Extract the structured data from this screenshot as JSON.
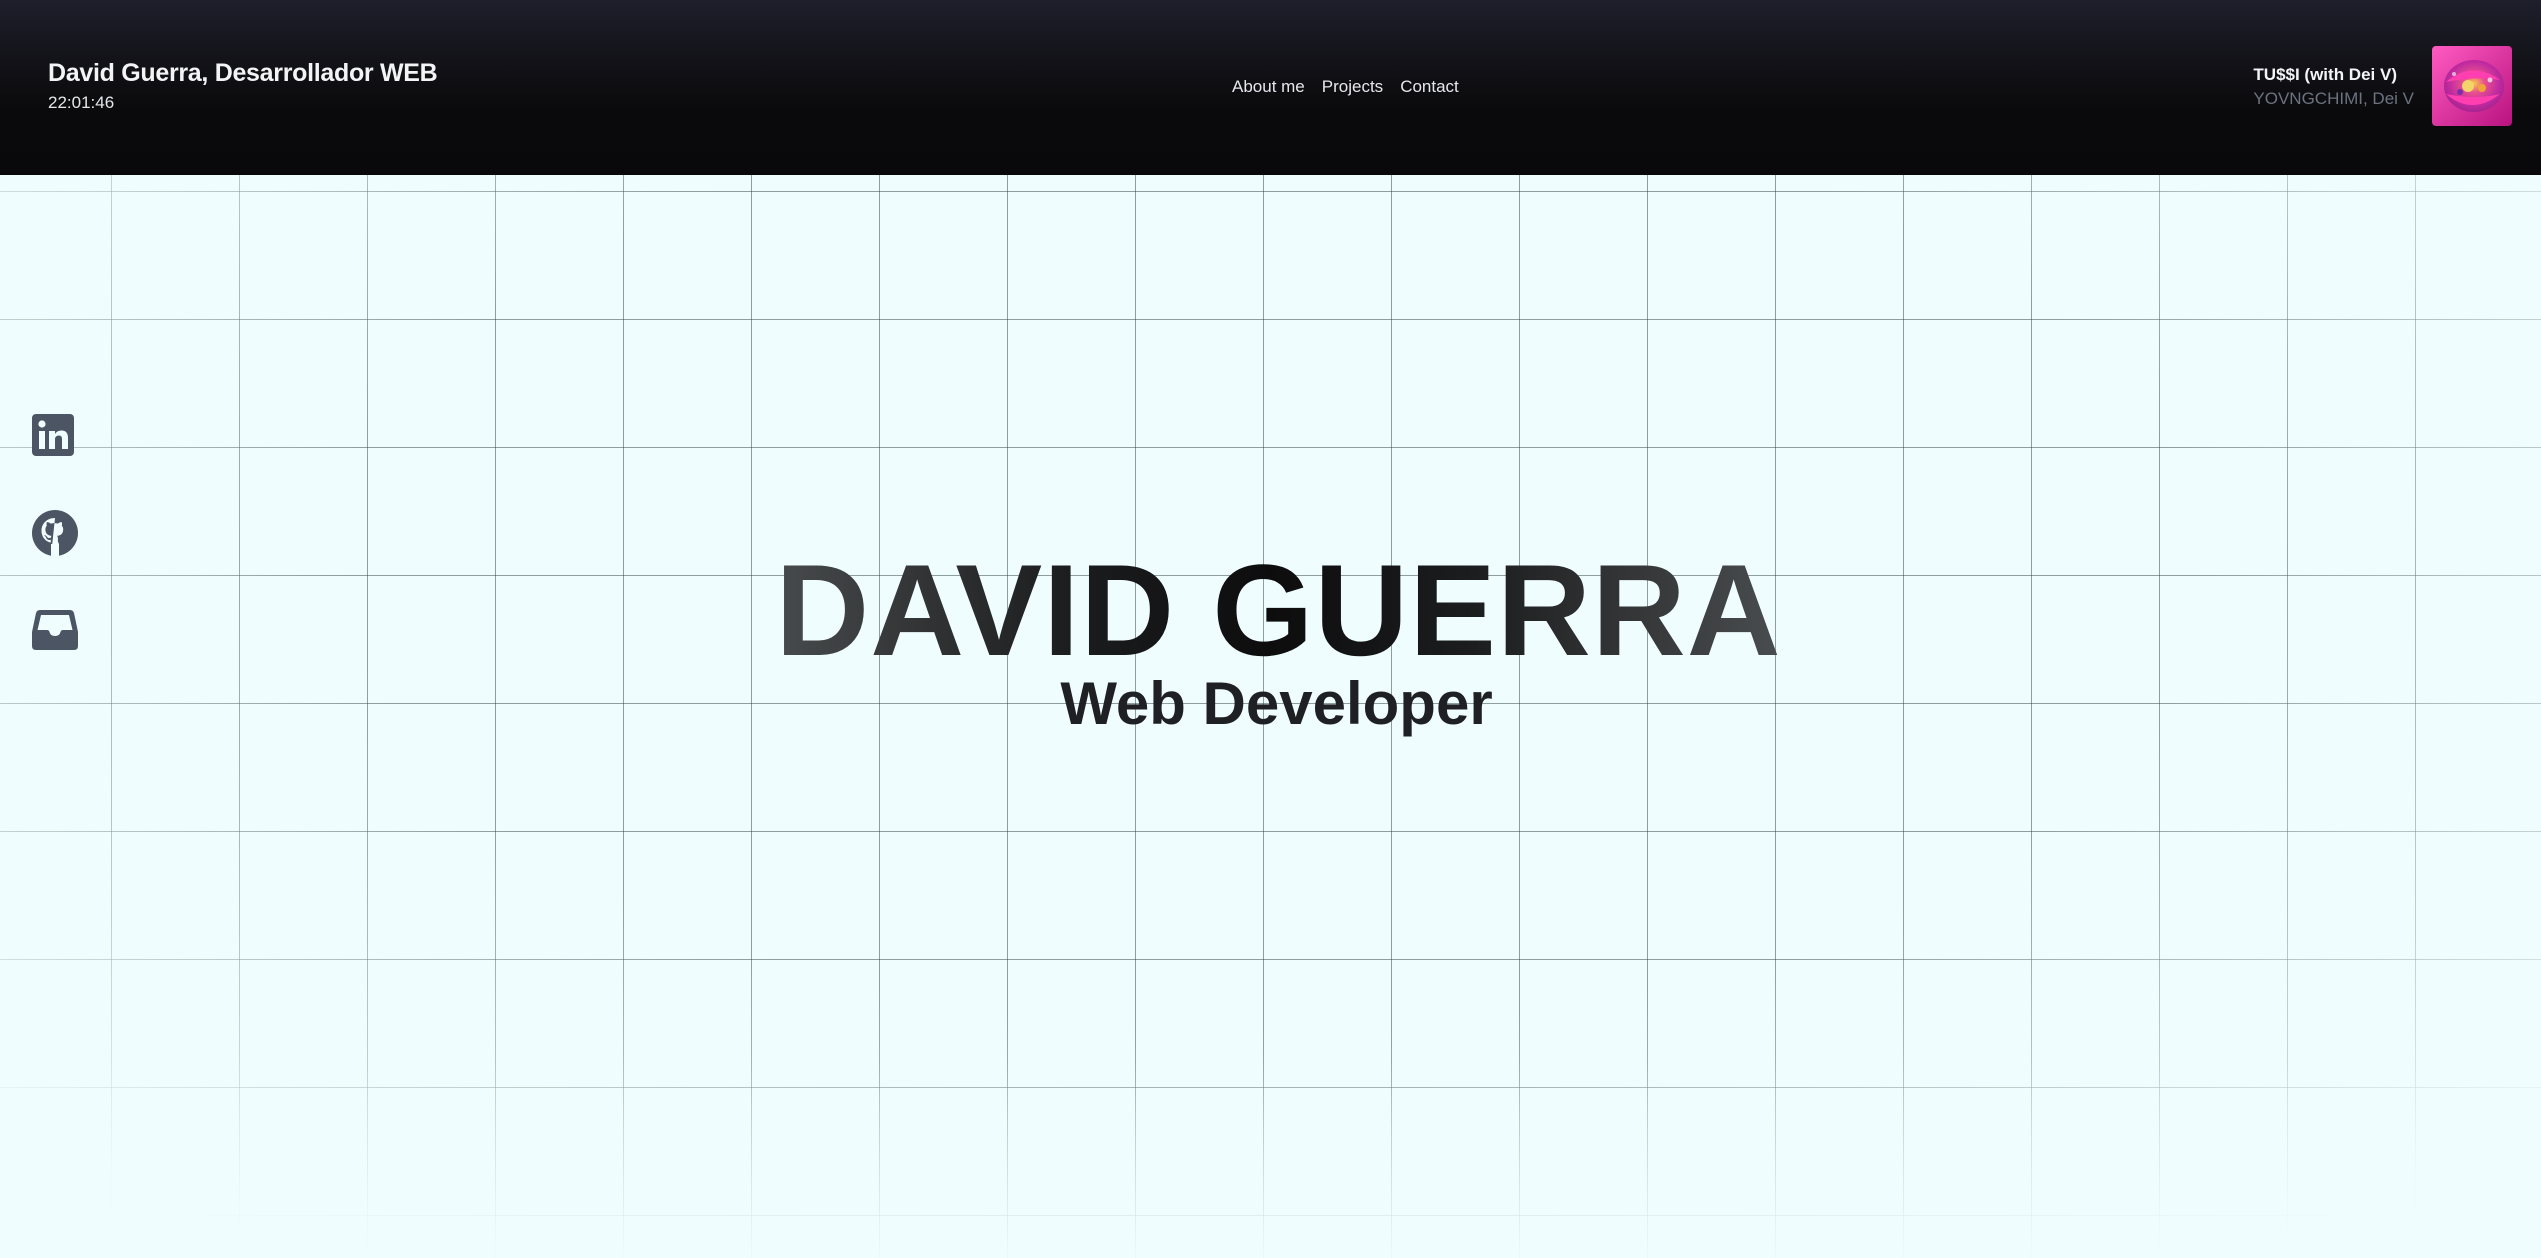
{
  "header": {
    "brand_title": "David Guerra, Desarrollador WEB",
    "clock": "22:01:46",
    "nav": [
      {
        "label": "About me"
      },
      {
        "label": "Projects"
      },
      {
        "label": "Contact"
      }
    ],
    "now_playing": {
      "title": "TU$$I (with Dei V)",
      "artist": "YOVNGCHIMI, Dei V",
      "album_icon": "album-art"
    }
  },
  "social": [
    {
      "icon": "linkedin-icon"
    },
    {
      "icon": "github-icon"
    },
    {
      "icon": "inbox-icon"
    }
  ],
  "hero": {
    "name": "DAVID GUERRA",
    "role": "Web Developer"
  },
  "colors": {
    "header_bg": "#09090b",
    "page_bg": "#f0fdfe",
    "icon": "#4b5563",
    "hero_text": "#1f2023"
  }
}
